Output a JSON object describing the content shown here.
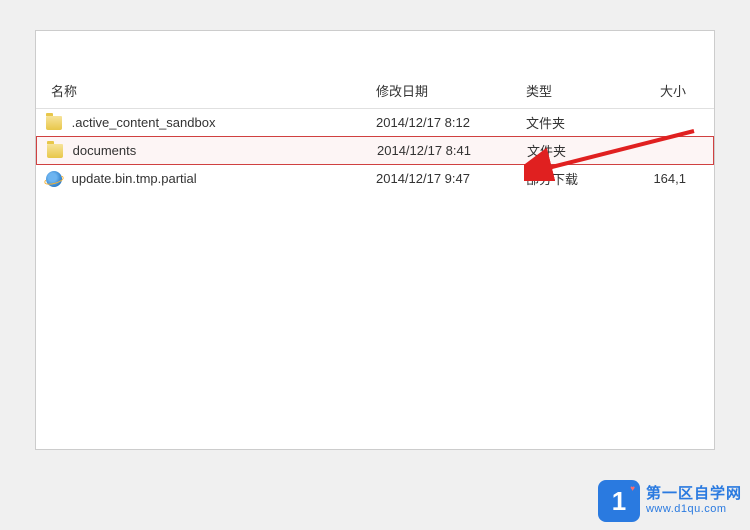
{
  "headers": {
    "name": "名称",
    "date": "修改日期",
    "type": "类型",
    "size": "大小"
  },
  "files": [
    {
      "name": ".active_content_sandbox",
      "date": "2014/12/17 8:12",
      "type": "文件夹",
      "size": "",
      "icon": "folder"
    },
    {
      "name": "documents",
      "date": "2014/12/17 8:41",
      "type": "文件夹",
      "size": "",
      "icon": "folder"
    },
    {
      "name": "update.bin.tmp.partial",
      "date": "2014/12/17 9:47",
      "type": "部分下载",
      "size": "164,1",
      "icon": "ie"
    }
  ],
  "watermark": {
    "badge": "1",
    "title": "第一区自学网",
    "url": "www.d1qu.com"
  }
}
